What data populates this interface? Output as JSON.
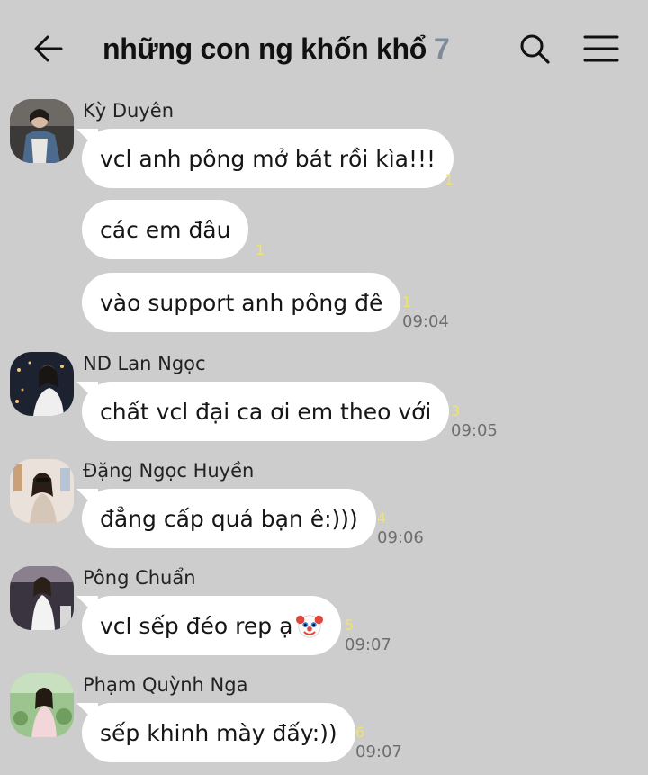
{
  "header": {
    "title": "những con ng khốn khổ",
    "member_count": "7",
    "back_icon": "arrow-left-icon",
    "search_icon": "search-icon",
    "menu_icon": "hamburger-menu-icon"
  },
  "colors": {
    "background": "#cdcdcd",
    "bubble": "#ffffff",
    "read_count": "#f2e36b",
    "member_count": "#7c8a99",
    "timestamp": "#6e6e6e"
  },
  "messages": [
    {
      "sender": "Kỳ Duyên",
      "bubbles": [
        {
          "text": "vcl anh pông mở bát rồi kìa!!!",
          "read_count": "1",
          "time": ""
        },
        {
          "text": "các em đâu",
          "read_count": "1",
          "time": ""
        },
        {
          "text": "vào support anh pông đê",
          "read_count": "1",
          "time": "09:04"
        }
      ]
    },
    {
      "sender": "ND Lan Ngọc",
      "bubbles": [
        {
          "text": "chất vcl đại ca ơi em theo với",
          "read_count": "3",
          "time": "09:05"
        }
      ]
    },
    {
      "sender": "Đặng Ngọc Huyền",
      "bubbles": [
        {
          "text": "đẳng cấp quá bạn ê:)))",
          "read_count": "4",
          "time": "09:06"
        }
      ]
    },
    {
      "sender": "Pông Chuẩn",
      "bubbles": [
        {
          "text": "vcl sếp đéo rep ạ",
          "read_count": "5",
          "time": "09:07",
          "emoji": "clown-face-icon"
        }
      ]
    },
    {
      "sender": "Phạm Quỳnh Nga",
      "bubbles": [
        {
          "text": "sếp khinh mày đấy:))",
          "read_count": "6",
          "time": "09:07"
        }
      ]
    }
  ]
}
